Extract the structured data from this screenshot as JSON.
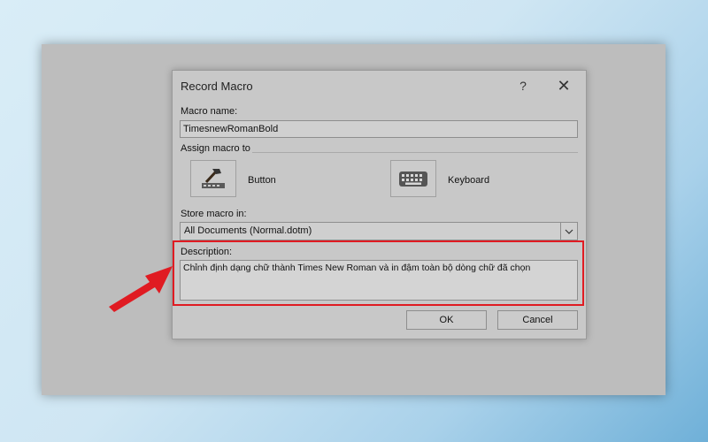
{
  "dialog": {
    "title": "Record Macro",
    "help_glyph": "?",
    "close_glyph": "✕",
    "macro_name_label": "Macro name:",
    "macro_name_value": "TimesnewRomanBold",
    "assign_label": "Assign macro to",
    "button_option_label": "Button",
    "keyboard_option_label": "Keyboard",
    "store_label": "Store macro in:",
    "store_value": "All Documents (Normal.dotm)",
    "description_label": "Description:",
    "description_value": "Chỉnh định dạng chữ thành Times New Roman và in đậm toàn bộ dòng chữ đã chọn",
    "ok_label": "OK",
    "cancel_label": "Cancel"
  },
  "annotation": {
    "highlight_color": "#e01b22",
    "arrow_color": "#e01b22"
  },
  "icons": {
    "button_icon": "hammer-toolbar-icon",
    "keyboard_icon": "keyboard-icon",
    "dropdown_icon": "chevron-down-icon",
    "help_icon": "question-mark-icon",
    "close_icon": "close-icon"
  }
}
